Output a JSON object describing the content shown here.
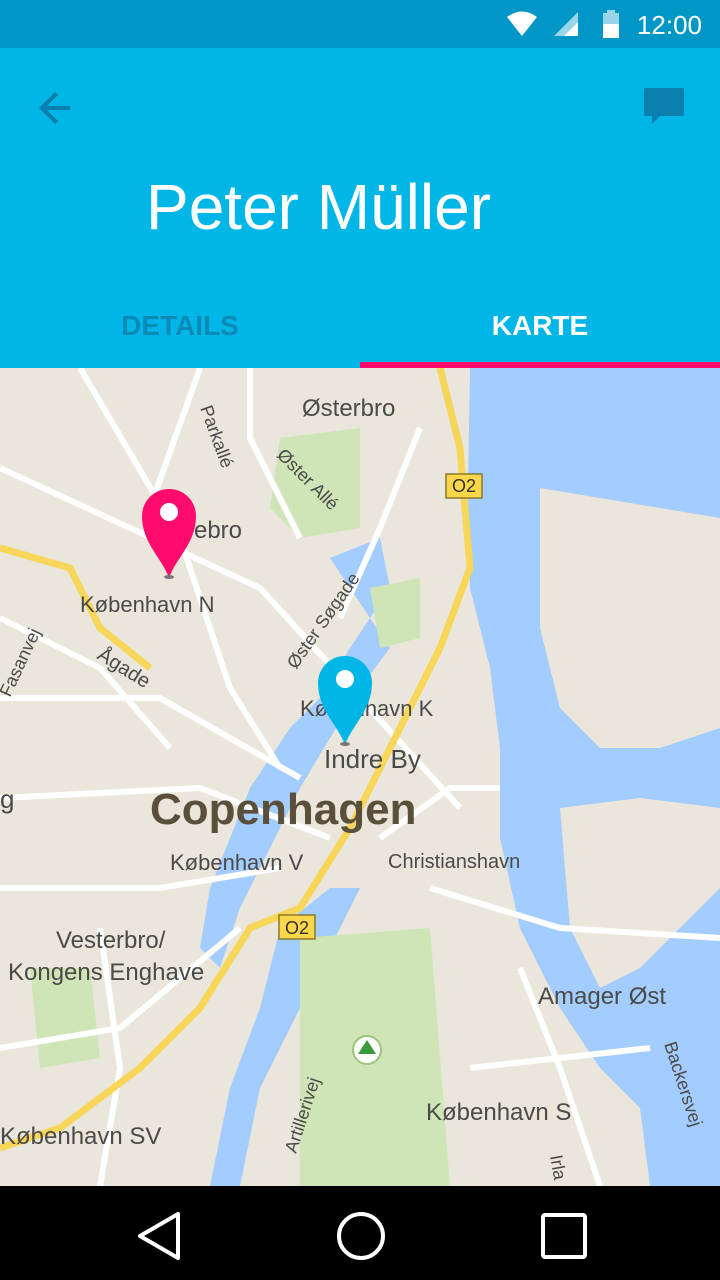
{
  "status_bar": {
    "time": "12:00",
    "icons": [
      "wifi-icon",
      "signal-icon",
      "battery-icon"
    ]
  },
  "app_bar": {
    "title": "Peter Müller",
    "icons": {
      "back": "arrow-back-icon",
      "message": "chat-bubble-icon"
    },
    "tabs": [
      {
        "label": "DETAILS",
        "selected": false
      },
      {
        "label": "KARTE",
        "selected": true
      }
    ],
    "colors": {
      "primary": "#00b6e6",
      "status": "#0097c7",
      "accent": "#ff0a6d"
    }
  },
  "map": {
    "labels": {
      "osterbro": "Østerbro",
      "nørrebro": "Nørrebro",
      "kobenhavn_n": "København N",
      "agade": "Ågade",
      "fasanvej": "Fasanvej",
      "parkalle": "Parkallé",
      "oster_alle": "Øster Allé",
      "oster_sogade": "Øster Søgade",
      "kobenhavn_k": "København K",
      "indre_by": "Indre By",
      "copenhagen": "Copenhagen",
      "kobenhavn_v": "København V",
      "christianshavn": "Christianshavn",
      "vesterbro": "Vesterbro/",
      "kongens_enghave": "Kongens Enghave",
      "amager_ost": "Amager Øst",
      "kobenhavn_s": "København S",
      "kobenhavn_sv": "København SV",
      "artillerivej": "Artillerivej",
      "backersvej": "Backersvej",
      "o2_top": "O2",
      "o2_bottom": "O2",
      "left_edge": "g",
      "irla": "Irla"
    },
    "markers": [
      {
        "name": "pink-marker",
        "color": "#ff0a6d"
      },
      {
        "name": "blue-marker",
        "color": "#00b6e6"
      }
    ]
  },
  "nav_bar": {
    "icons": [
      "back-triangle-icon",
      "home-circle-icon",
      "recents-square-icon"
    ]
  }
}
